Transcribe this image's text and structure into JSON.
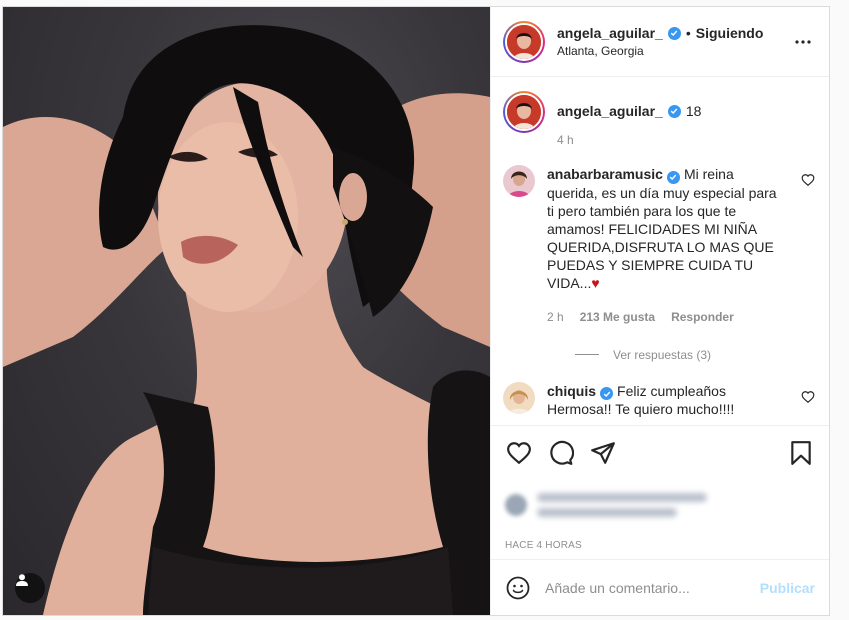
{
  "post": {
    "author": "angela_aguilar_",
    "follow_state": "Siguiendo",
    "separator": "•",
    "location": "Atlanta, Georgia",
    "more_icon": "more-horizontal-icon",
    "user_tag_icon": "user-tag-icon"
  },
  "caption": {
    "username": "angela_aguilar_",
    "text": "18",
    "time": "4 h"
  },
  "comments": [
    {
      "username": "anabarbaramusic",
      "verified": true,
      "text": "Mi reina querida, es un día muy especial para ti pero también para los que te amamos! FELICIDADES MI NIÑA QUERIDA,DISFRUTA LO MAS QUE PUEDAS Y SIEMPRE CUIDA TU VIDA...",
      "heart": "♥",
      "time": "2 h",
      "likes": "213 Me gusta",
      "reply": "Responder",
      "view_replies": "Ver respuestas (3)"
    },
    {
      "username": "chiquis",
      "verified": true,
      "text": "Feliz cumpleaños Hermosa!! Te quiero mucho!!!!"
    }
  ],
  "actions": {
    "like_icon": "heart-icon",
    "comment_icon": "comment-icon",
    "share_icon": "share-icon",
    "save_icon": "bookmark-icon"
  },
  "timestamp": "HACE 4 HORAS",
  "add_comment": {
    "placeholder": "Añade un comentario...",
    "post_label": "Publicar",
    "emoji_icon": "emoji-icon"
  },
  "colors": {
    "verified": "#3897f0",
    "link_disabled": "#b2dffc",
    "muted_text": "#8e8e8e"
  }
}
